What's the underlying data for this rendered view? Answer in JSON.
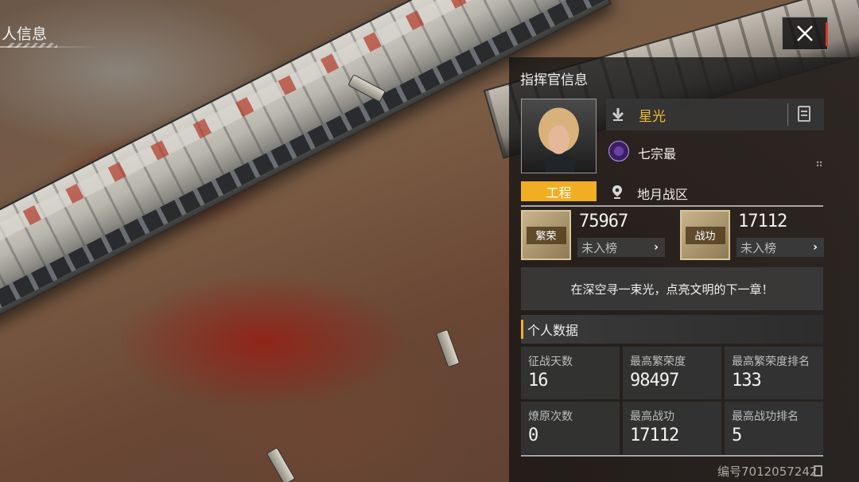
{
  "window": {
    "title": "人信息"
  },
  "panel": {
    "title": "指挥官信息",
    "player": {
      "name": "星光",
      "alliance": "七宗最",
      "tag": "工程",
      "zone": "地月战区"
    },
    "stats": [
      {
        "badge": "繁荣",
        "value": "75967",
        "rank": "未入榜"
      },
      {
        "badge": "战功",
        "value": "17112",
        "rank": "未入榜"
      }
    ],
    "slogan": "在深空寻一束光，点亮文明的下一章！",
    "personal_data": {
      "heading": "个人数据",
      "cells": [
        {
          "label": "征战天数",
          "value": "16"
        },
        {
          "label": "最高繁荣度",
          "value": "98497"
        },
        {
          "label": "最高繁荣度排名",
          "value": "133"
        },
        {
          "label": "燎原次数",
          "value": "0"
        },
        {
          "label": "最高战功",
          "value": "17112"
        },
        {
          "label": "最高战功排名",
          "value": "5"
        }
      ]
    },
    "id_text": "编号7012057242"
  },
  "colors": {
    "accent": "#f2ae22",
    "name": "#f2b83a",
    "close_stripe": "#d63a2a"
  },
  "icons": [
    "close-icon",
    "rank-chevron-icon",
    "document-icon",
    "alliance-emblem-icon",
    "location-pin-icon",
    "chevron-right-icon",
    "copy-icon"
  ]
}
